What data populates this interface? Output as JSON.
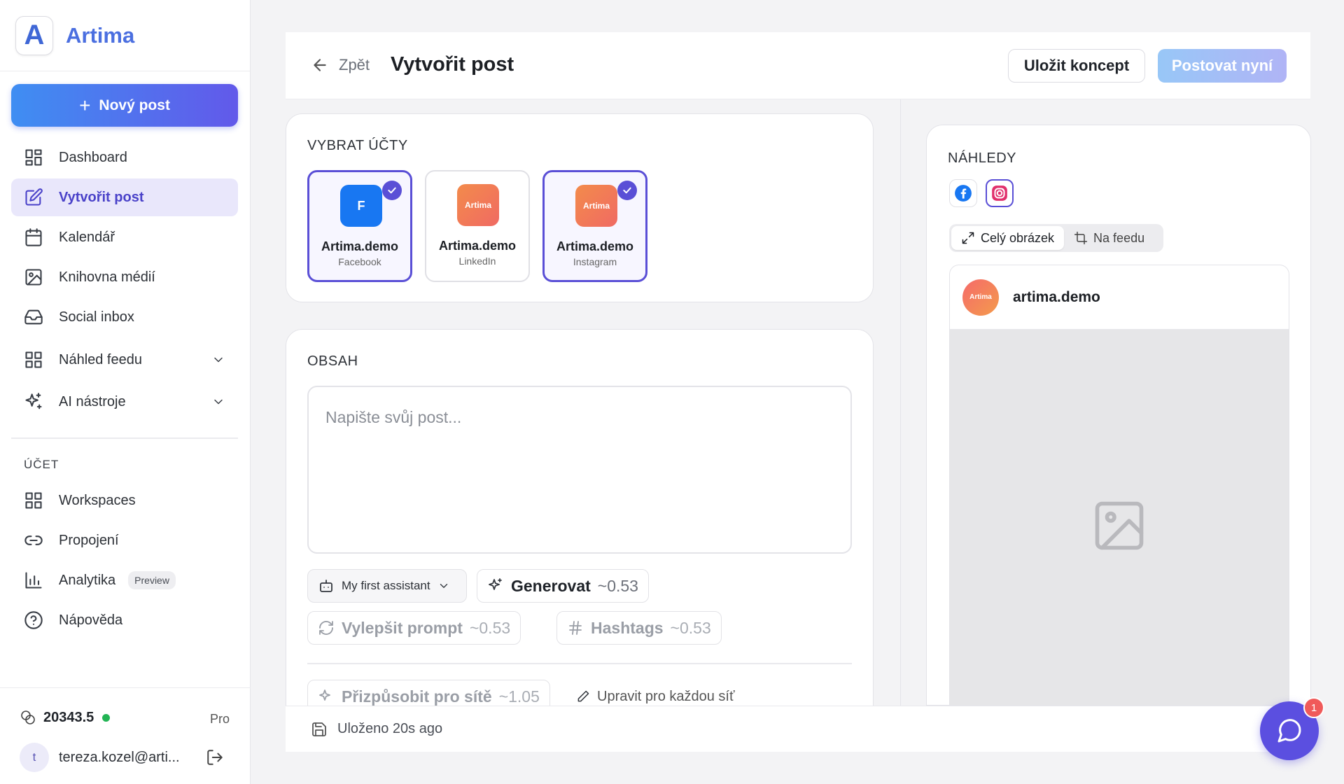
{
  "brand": {
    "letter": "A",
    "name": "Artima"
  },
  "sidebar": {
    "new_post": "Nový post",
    "items": [
      {
        "label": "Dashboard",
        "icon": "dashboard-icon"
      },
      {
        "label": "Vytvořit post",
        "icon": "edit-icon",
        "active": true
      },
      {
        "label": "Kalendář",
        "icon": "calendar-icon"
      },
      {
        "label": "Knihovna médií",
        "icon": "image-icon"
      },
      {
        "label": "Social inbox",
        "icon": "inbox-icon"
      },
      {
        "label": "Náhled feedu",
        "icon": "grid-icon",
        "expandable": true
      },
      {
        "label": "AI nástroje",
        "icon": "sparkles-icon",
        "expandable": true
      }
    ],
    "account_section": "ÚČET",
    "account_items": [
      {
        "label": "Workspaces",
        "icon": "grid-icon"
      },
      {
        "label": "Propojení",
        "icon": "link-icon"
      },
      {
        "label": "Analytika",
        "icon": "chart-icon",
        "badge": "Preview"
      },
      {
        "label": "Nápověda",
        "icon": "help-icon"
      }
    ],
    "footer": {
      "credits": "20343.5",
      "plan": "Pro",
      "avatar_letter": "t",
      "email": "tereza.kozel@arti..."
    }
  },
  "header": {
    "back": "Zpět",
    "title": "Vytvořit post",
    "save_draft": "Uložit koncept",
    "post_now": "Postovat nyní"
  },
  "accounts": {
    "title": "VYBRAT ÚČTY",
    "list": [
      {
        "name": "Artima.demo",
        "network": "Facebook",
        "avatar": "F",
        "selected": true
      },
      {
        "name": "Artima.demo",
        "network": "LinkedIn",
        "avatar": "Artima",
        "selected": false
      },
      {
        "name": "Artima.demo",
        "network": "Instagram",
        "avatar": "Artima",
        "selected": true
      }
    ]
  },
  "content": {
    "title": "OBSAH",
    "placeholder": "Napište svůj post...",
    "assistant": "My first assistant",
    "generate": "Generovat",
    "generate_cost": "~0.53",
    "improve": "Vylepšit prompt",
    "improve_cost": "~0.53",
    "hashtags": "Hashtags",
    "hashtags_cost": "~0.53",
    "adapt": "Přizpůsobit pro sítě",
    "adapt_cost": "~1.05",
    "edit_each": "Upravit pro každou síť"
  },
  "status": {
    "saved": "Uloženo 20s ago"
  },
  "previews": {
    "title": "NÁHLEDY",
    "tabs": [
      "Celý obrázek",
      "Na feedu"
    ],
    "account": "artima.demo",
    "avatar_text": "Artima"
  },
  "chat": {
    "badge": "1"
  },
  "colors": {
    "accent": "#5a4fd6",
    "facebook": "#1877f2",
    "success": "#22b454"
  }
}
